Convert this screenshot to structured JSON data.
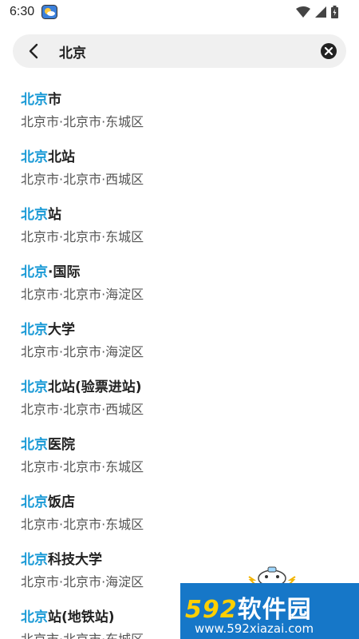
{
  "status_bar": {
    "time": "6:30",
    "icons": [
      "weather-app-icon",
      "wifi-icon",
      "cell-signal-icon",
      "battery-icon"
    ]
  },
  "search": {
    "query": "北京",
    "back_icon": "chevron-left-icon",
    "clear_icon": "clear-circle-icon"
  },
  "highlight_color": "#1a9ad6",
  "results": [
    {
      "highlight": "北京",
      "rest": "市",
      "subtitle": "北京市·北京市·东城区"
    },
    {
      "highlight": "北京",
      "rest": "北站",
      "subtitle": "北京市·北京市·西城区"
    },
    {
      "highlight": "北京",
      "rest": "站",
      "subtitle": "北京市·北京市·东城区"
    },
    {
      "highlight": "北京",
      "rest": "·国际",
      "subtitle": "北京市·北京市·海淀区"
    },
    {
      "highlight": "北京",
      "rest": "大学",
      "subtitle": "北京市·北京市·海淀区"
    },
    {
      "highlight": "北京",
      "rest": "北站(验票进站)",
      "subtitle": "北京市·北京市·西城区"
    },
    {
      "highlight": "北京",
      "rest": "医院",
      "subtitle": "北京市·北京市·东城区"
    },
    {
      "highlight": "北京",
      "rest": "饭店",
      "subtitle": "北京市·北京市·东城区"
    },
    {
      "highlight": "北京",
      "rest": "科技大学",
      "subtitle": "北京市·北京市·海淀区"
    },
    {
      "highlight": "北京",
      "rest": "站(地铁站)",
      "subtitle": "北京市·北京市·东城区"
    }
  ],
  "watermark": {
    "logo_number": "592",
    "logo_text": "软件园",
    "url": "www.592xiazai.com"
  }
}
